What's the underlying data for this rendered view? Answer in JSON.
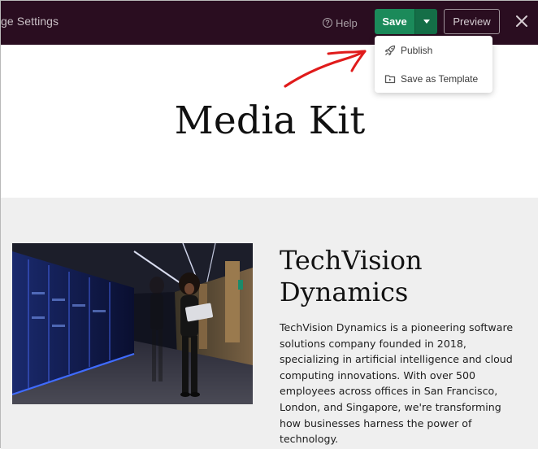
{
  "topbar": {
    "page_settings_label": "ge Settings",
    "help_label": "Help",
    "save_label": "Save",
    "preview_label": "Preview"
  },
  "save_menu": {
    "items": [
      {
        "label": "Publish",
        "icon": "rocket-icon"
      },
      {
        "label": "Save as Template",
        "icon": "folder-template-icon"
      }
    ]
  },
  "hero": {
    "title": "Media Kit"
  },
  "company": {
    "name_line1": "TechVision",
    "name_line2": "Dynamics",
    "description": "TechVision Dynamics is a pioneering software solutions company founded in 2018, specializing in artificial intelligence and cloud computing innovations. With over 500 employees across offices in San Francisco, London, and Singapore, we're transforming how businesses harness the power of technology."
  },
  "colors": {
    "topbar_bg": "#2a0d20",
    "save_green": "#1b8a5a",
    "annotation_red": "#e01b1b",
    "section_bg": "#efefef"
  }
}
